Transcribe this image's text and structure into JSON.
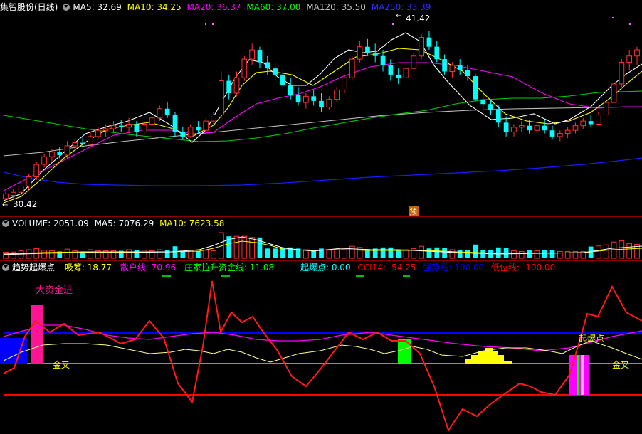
{
  "main_header": {
    "stock": "集智股份(日线)",
    "ma5": "MA5: 32.69",
    "ma10": "MA10: 34.25",
    "ma20": "MA20: 36.37",
    "ma60": "MA60: 37.00",
    "ma120": "MA120: 35.50",
    "ma250": "MA250: 33.39"
  },
  "price_labels": {
    "high": "41.42",
    "low": "30.42"
  },
  "marker_yu": "预",
  "vol_header": {
    "vol": "VOLUME: 2051.09",
    "ma5": "MA5: 7076.29",
    "ma10": "MA10: 7623.58"
  },
  "ind_header": {
    "name": "趋势起爆点",
    "xichou": "吸筹: 18.77",
    "sanhu": "散户线: 70.96",
    "zhuangjia": "庄家拉升资金线: 11.08",
    "qibaodian": "起爆点: 0.00",
    "cci": "CCI14: -54.25",
    "qiangshi": "强势线: 100.00",
    "diwei": "低位线: -100.00"
  },
  "annotations": {
    "big_money": "大资金进",
    "golden_cross_1": "金叉",
    "golden_cross_2": "金叉",
    "explosion": "起爆点"
  },
  "colors": {
    "up": "#ff3232",
    "down": "#00ffff",
    "ma5": "#ffffff",
    "ma10": "#ffff00",
    "ma20": "#ff00ff",
    "ma60": "#00ff00",
    "ma120": "#c0c0c0",
    "ma250": "#0000ff"
  },
  "chart_data": {
    "type": "candlestick",
    "title": "集智股份(日线)",
    "candles": [
      {
        "o": 30.6,
        "h": 31.0,
        "l": 30.42,
        "c": 30.9
      },
      {
        "o": 30.8,
        "h": 31.2,
        "l": 30.6,
        "c": 31.0
      },
      {
        "o": 31.0,
        "h": 31.6,
        "l": 30.8,
        "c": 31.4
      },
      {
        "o": 31.4,
        "h": 32.2,
        "l": 31.2,
        "c": 32.0
      },
      {
        "o": 32.0,
        "h": 33.0,
        "l": 31.8,
        "c": 32.8
      },
      {
        "o": 32.8,
        "h": 33.5,
        "l": 32.6,
        "c": 33.3
      },
      {
        "o": 33.3,
        "h": 33.8,
        "l": 33.0,
        "c": 33.6
      },
      {
        "o": 33.6,
        "h": 33.9,
        "l": 33.2,
        "c": 33.4
      },
      {
        "o": 33.4,
        "h": 34.3,
        "l": 33.2,
        "c": 34.0
      },
      {
        "o": 34.0,
        "h": 34.4,
        "l": 33.6,
        "c": 34.2
      },
      {
        "o": 34.2,
        "h": 34.6,
        "l": 33.9,
        "c": 34.1
      },
      {
        "o": 34.1,
        "h": 34.9,
        "l": 33.9,
        "c": 34.6
      },
      {
        "o": 34.6,
        "h": 35.2,
        "l": 34.4,
        "c": 35.0
      },
      {
        "o": 35.0,
        "h": 35.4,
        "l": 34.6,
        "c": 35.1
      },
      {
        "o": 35.1,
        "h": 35.6,
        "l": 34.8,
        "c": 35.3
      },
      {
        "o": 35.3,
        "h": 35.7,
        "l": 34.9,
        "c": 35.2
      },
      {
        "o": 35.2,
        "h": 35.8,
        "l": 34.8,
        "c": 35.4
      },
      {
        "o": 35.4,
        "h": 35.6,
        "l": 34.6,
        "c": 34.9
      },
      {
        "o": 34.9,
        "h": 35.6,
        "l": 34.7,
        "c": 35.4
      },
      {
        "o": 35.4,
        "h": 36.0,
        "l": 35.2,
        "c": 35.8
      },
      {
        "o": 35.8,
        "h": 36.6,
        "l": 35.6,
        "c": 36.4
      },
      {
        "o": 36.4,
        "h": 36.8,
        "l": 35.8,
        "c": 36.0
      },
      {
        "o": 36.0,
        "h": 36.2,
        "l": 34.6,
        "c": 34.9
      },
      {
        "o": 34.9,
        "h": 35.2,
        "l": 34.4,
        "c": 34.6
      },
      {
        "o": 34.6,
        "h": 35.4,
        "l": 34.5,
        "c": 35.2
      },
      {
        "o": 35.2,
        "h": 35.6,
        "l": 34.8,
        "c": 35.0
      },
      {
        "o": 35.0,
        "h": 35.8,
        "l": 34.9,
        "c": 35.6
      },
      {
        "o": 35.6,
        "h": 36.2,
        "l": 35.4,
        "c": 36.0
      },
      {
        "o": 36.0,
        "h": 38.8,
        "l": 35.8,
        "c": 38.2
      },
      {
        "o": 38.2,
        "h": 38.6,
        "l": 37.0,
        "c": 37.4
      },
      {
        "o": 37.4,
        "h": 38.8,
        "l": 37.2,
        "c": 38.4
      },
      {
        "o": 38.4,
        "h": 39.8,
        "l": 38.2,
        "c": 39.6
      },
      {
        "o": 39.6,
        "h": 40.6,
        "l": 39.2,
        "c": 40.2
      },
      {
        "o": 40.2,
        "h": 40.4,
        "l": 39.0,
        "c": 39.4
      },
      {
        "o": 39.4,
        "h": 39.8,
        "l": 38.6,
        "c": 39.0
      },
      {
        "o": 39.0,
        "h": 39.4,
        "l": 38.2,
        "c": 38.6
      },
      {
        "o": 38.6,
        "h": 39.0,
        "l": 37.6,
        "c": 37.9
      },
      {
        "o": 37.9,
        "h": 38.4,
        "l": 37.0,
        "c": 37.3
      },
      {
        "o": 37.3,
        "h": 37.8,
        "l": 36.6,
        "c": 36.8
      },
      {
        "o": 36.8,
        "h": 37.4,
        "l": 36.4,
        "c": 37.2
      },
      {
        "o": 37.2,
        "h": 37.6,
        "l": 36.6,
        "c": 36.9
      },
      {
        "o": 36.9,
        "h": 37.4,
        "l": 36.2,
        "c": 36.5
      },
      {
        "o": 36.5,
        "h": 37.2,
        "l": 36.3,
        "c": 37.0
      },
      {
        "o": 37.0,
        "h": 37.8,
        "l": 36.8,
        "c": 37.6
      },
      {
        "o": 37.6,
        "h": 38.6,
        "l": 37.4,
        "c": 38.4
      },
      {
        "o": 38.4,
        "h": 39.8,
        "l": 38.2,
        "c": 39.6
      },
      {
        "o": 39.6,
        "h": 40.8,
        "l": 39.4,
        "c": 40.4
      },
      {
        "o": 40.4,
        "h": 40.9,
        "l": 39.8,
        "c": 40.0
      },
      {
        "o": 40.0,
        "h": 40.6,
        "l": 39.4,
        "c": 39.8
      },
      {
        "o": 39.8,
        "h": 40.2,
        "l": 38.8,
        "c": 39.2
      },
      {
        "o": 39.2,
        "h": 39.6,
        "l": 38.2,
        "c": 38.6
      },
      {
        "o": 38.6,
        "h": 39.0,
        "l": 38.0,
        "c": 38.4
      },
      {
        "o": 38.4,
        "h": 39.2,
        "l": 38.2,
        "c": 39.0
      },
      {
        "o": 39.0,
        "h": 40.0,
        "l": 38.8,
        "c": 39.8
      },
      {
        "o": 39.8,
        "h": 41.2,
        "l": 39.6,
        "c": 41.0
      },
      {
        "o": 41.0,
        "h": 41.42,
        "l": 40.2,
        "c": 40.4
      },
      {
        "o": 40.4,
        "h": 40.8,
        "l": 39.4,
        "c": 39.6
      },
      {
        "o": 39.6,
        "h": 39.9,
        "l": 38.6,
        "c": 38.8
      },
      {
        "o": 38.8,
        "h": 39.4,
        "l": 38.4,
        "c": 39.2
      },
      {
        "o": 39.2,
        "h": 39.6,
        "l": 38.6,
        "c": 38.9
      },
      {
        "o": 38.9,
        "h": 39.2,
        "l": 38.2,
        "c": 38.5
      },
      {
        "o": 38.5,
        "h": 38.7,
        "l": 36.8,
        "c": 37.0
      },
      {
        "o": 37.0,
        "h": 37.3,
        "l": 36.4,
        "c": 36.7
      },
      {
        "o": 36.7,
        "h": 37.0,
        "l": 36.0,
        "c": 36.3
      },
      {
        "o": 36.3,
        "h": 36.6,
        "l": 35.2,
        "c": 35.5
      },
      {
        "o": 35.5,
        "h": 35.9,
        "l": 34.6,
        "c": 34.9
      },
      {
        "o": 34.9,
        "h": 35.4,
        "l": 34.6,
        "c": 35.2
      },
      {
        "o": 35.2,
        "h": 35.6,
        "l": 34.9,
        "c": 35.3
      },
      {
        "o": 35.3,
        "h": 35.7,
        "l": 34.8,
        "c": 35.0
      },
      {
        "o": 35.0,
        "h": 35.5,
        "l": 34.7,
        "c": 35.3
      },
      {
        "o": 35.3,
        "h": 35.7,
        "l": 34.8,
        "c": 35.0
      },
      {
        "o": 35.0,
        "h": 35.3,
        "l": 34.4,
        "c": 34.6
      },
      {
        "o": 34.6,
        "h": 35.0,
        "l": 34.3,
        "c": 34.8
      },
      {
        "o": 34.8,
        "h": 35.2,
        "l": 34.5,
        "c": 35.0
      },
      {
        "o": 35.0,
        "h": 35.5,
        "l": 34.8,
        "c": 35.3
      },
      {
        "o": 35.3,
        "h": 35.8,
        "l": 35.1,
        "c": 35.6
      },
      {
        "o": 35.6,
        "h": 36.0,
        "l": 35.2,
        "c": 35.4
      },
      {
        "o": 35.4,
        "h": 36.2,
        "l": 35.3,
        "c": 36.0
      },
      {
        "o": 36.0,
        "h": 37.0,
        "l": 35.9,
        "c": 36.8
      },
      {
        "o": 36.8,
        "h": 38.2,
        "l": 36.6,
        "c": 38.0
      },
      {
        "o": 38.0,
        "h": 39.6,
        "l": 37.8,
        "c": 39.4
      },
      {
        "o": 39.4,
        "h": 40.2,
        "l": 38.9,
        "c": 39.8
      },
      {
        "o": 39.8,
        "h": 40.4,
        "l": 39.2,
        "c": 40.2
      }
    ],
    "ylim": [
      30.0,
      42.5
    ]
  }
}
